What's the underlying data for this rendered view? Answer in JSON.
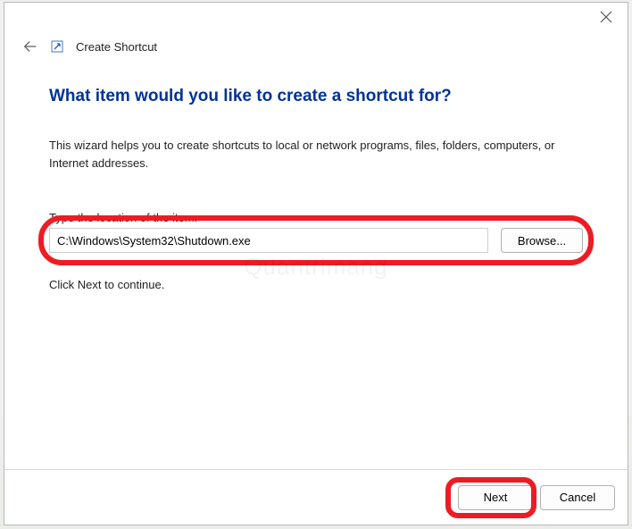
{
  "header": {
    "title": "Create Shortcut"
  },
  "main": {
    "heading": "What item would you like to create a shortcut for?",
    "description": "This wizard helps you to create shortcuts to local or network programs, files, folders, computers, or Internet addresses.",
    "location_label": "Type the location of the item:",
    "location_value": "C:\\Windows\\System32\\Shutdown.exe",
    "browse_label": "Browse...",
    "continue_text": "Click Next to continue."
  },
  "footer": {
    "next_label": "Next",
    "cancel_label": "Cancel"
  },
  "watermark": "Quantrimang"
}
